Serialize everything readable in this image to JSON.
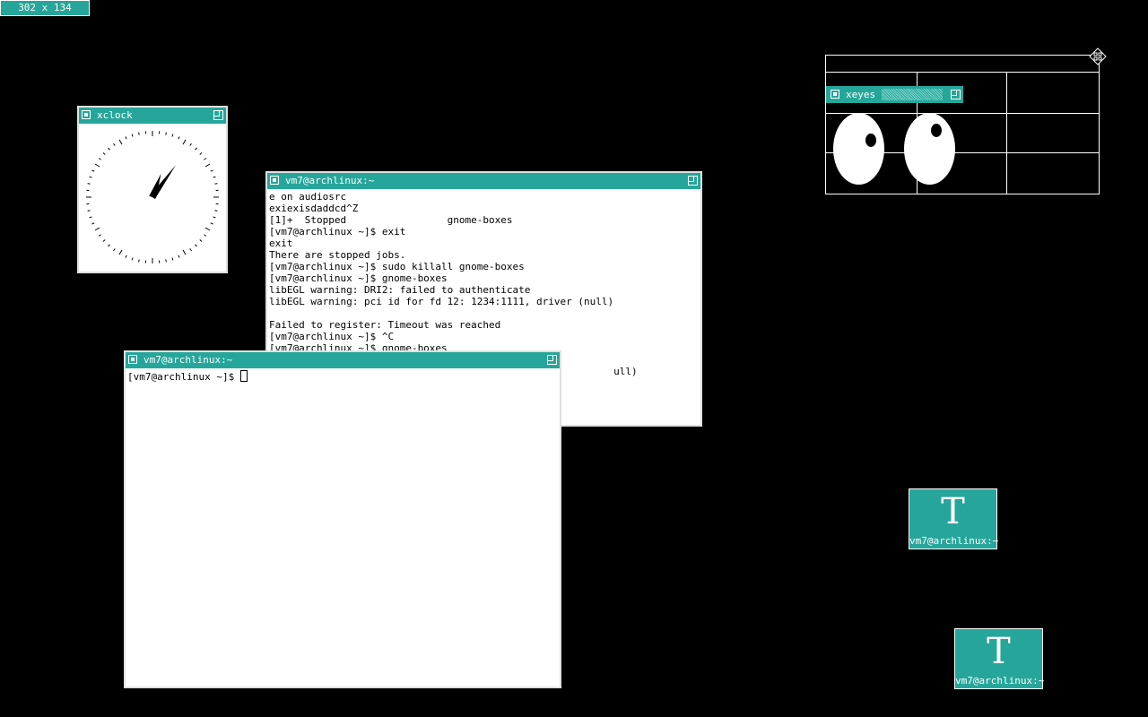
{
  "geometry_readout": "302 x 134",
  "xclock": {
    "title": "xclock"
  },
  "term_back": {
    "title": "vm7@archlinux:~",
    "lines": [
      "e on audiosrc",
      "exiexisdaddcd^Z",
      "[1]+  Stopped                 gnome-boxes",
      "[vm7@archlinux ~]$ exit",
      "exit",
      "There are stopped jobs.",
      "[vm7@archlinux ~]$ sudo killall gnome-boxes",
      "[vm7@archlinux ~]$ gnome-boxes",
      "libEGL warning: DRI2: failed to authenticate",
      "libEGL warning: pci id for fd 12: 1234:1111, driver (null)",
      "",
      "Failed to register: Timeout was reached",
      "[vm7@archlinux ~]$ ^C",
      "[vm7@archlinux ~]$ gnome-boxes",
      "",
      "                                                          ull)"
    ]
  },
  "term_front": {
    "title": "vm7@archlinux:~",
    "prompt": "[vm7@archlinux ~]$ "
  },
  "xeyes": {
    "title": "xeyes"
  },
  "icons": [
    {
      "label": "vm7@archlinux:~"
    },
    {
      "label": "vm7@archlinux:~"
    }
  ]
}
